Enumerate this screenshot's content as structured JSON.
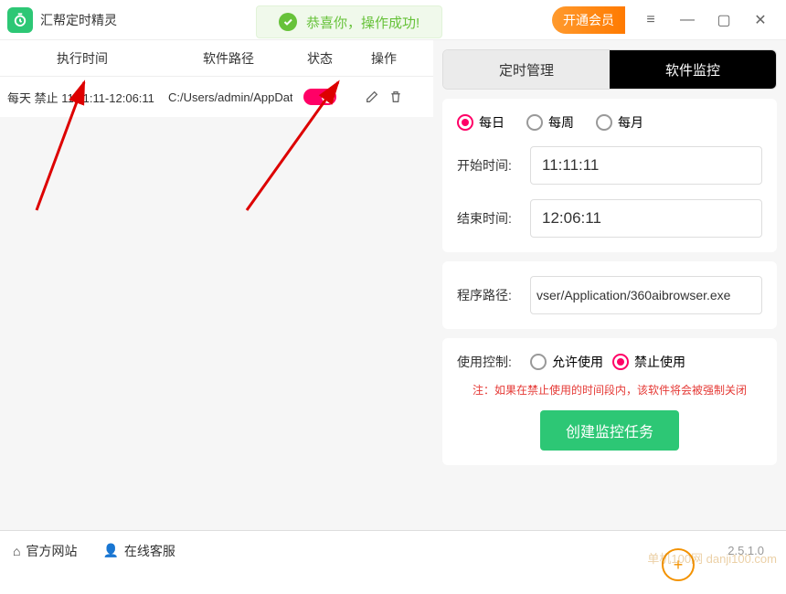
{
  "app": {
    "title": "汇帮定时精灵",
    "vip_badge": "开通会员"
  },
  "toast": {
    "text": "恭喜你，操作成功!"
  },
  "table": {
    "headers": {
      "time": "执行时间",
      "path": "软件路径",
      "status": "状态",
      "action": "操作"
    },
    "row": {
      "time": "每天 禁止 11:11:11-12:06:11",
      "path": "C:/Users/admin/AppData,"
    }
  },
  "tabs": {
    "schedule": "定时管理",
    "monitor": "软件监控"
  },
  "freq": {
    "daily": "每日",
    "weekly": "每周",
    "monthly": "每月"
  },
  "form": {
    "start_label": "开始时间:",
    "start_value": "11:11:11",
    "end_label": "结束时间:",
    "end_value": "12:06:11",
    "path_label": "程序路径:",
    "path_value": "vser/Application/360aibrowser.exe",
    "control_label": "使用控制:",
    "allow": "允许使用",
    "forbid": "禁止使用",
    "note": "注：如果在禁止使用的时间段内，该软件将会被强制关闭",
    "create": "创建监控任务"
  },
  "footer": {
    "site": "官方网站",
    "support": "在线客服",
    "version": "2.5.1.0"
  },
  "watermark": "单机100网\ndanji100.com"
}
